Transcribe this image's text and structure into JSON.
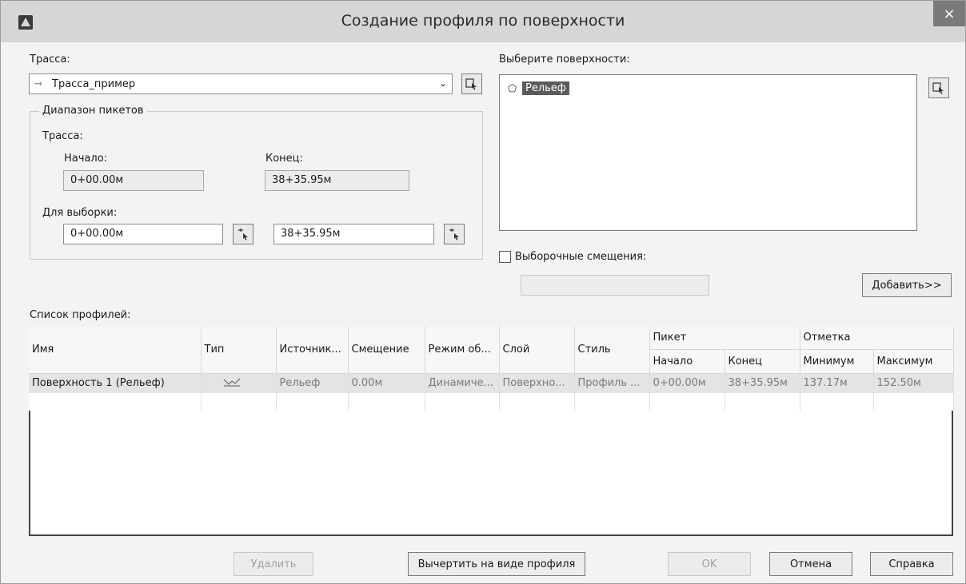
{
  "window": {
    "title": "Создание профиля по поверхности",
    "close_label": "×"
  },
  "alignment": {
    "label": "Трасса:",
    "value": "Трасса_пример"
  },
  "station_range": {
    "group_label": "Диапазон пикетов",
    "alignment_label": "Трасса:",
    "start_label": "Начало:",
    "end_label": "Конец:",
    "start_value": "0+00.00м",
    "end_value": "38+35.95м",
    "sample_label": "Для выборки:",
    "sample_start": "0+00.00м",
    "sample_end": "38+35.95м"
  },
  "surfaces": {
    "label": "Выберите поверхности:",
    "items": [
      "Рельеф"
    ]
  },
  "offsets": {
    "label": "Выборочные смещения:",
    "checked": false,
    "value": ""
  },
  "buttons": {
    "add": "Добавить>>",
    "delete": "Удалить",
    "draw": "Вычертить на виде профиля",
    "ok": "OK",
    "cancel": "Отмена",
    "help": "Справка"
  },
  "profile_list": {
    "label": "Список профилей:",
    "headers": {
      "name": "Имя",
      "type": "Тип",
      "source": "Источник...",
      "offset": "Смещение",
      "mode": "Режим об...",
      "layer": "Слой",
      "style": "Стиль",
      "station_group": "Пикет",
      "station_start": "Начало",
      "station_end": "Конец",
      "elevation_group": "Отметка",
      "elevation_min": "Минимум",
      "elevation_max": "Максимум"
    },
    "rows": [
      {
        "name": "Поверхность 1 (Рельеф)",
        "source": "Рельеф",
        "offset": "0.00м",
        "mode": "Динамиче...",
        "layer": "Поверхно...",
        "style": "Профиль ...",
        "start": "0+00.00м",
        "end": "38+35.95м",
        "min": "137.17м",
        "max": "152.50м"
      }
    ]
  }
}
